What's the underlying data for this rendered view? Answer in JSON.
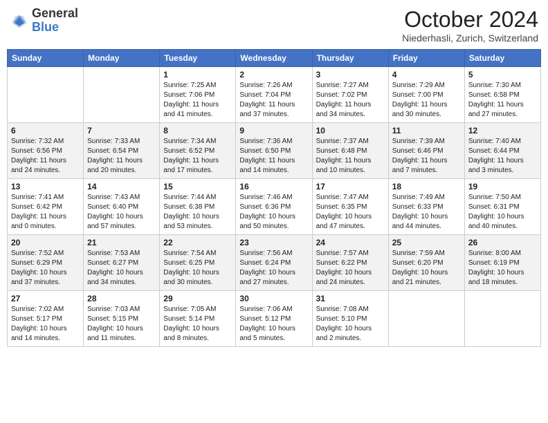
{
  "header": {
    "logo_general": "General",
    "logo_blue": "Blue",
    "month_title": "October 2024",
    "location": "Niederhasli, Zurich, Switzerland"
  },
  "weekdays": [
    "Sunday",
    "Monday",
    "Tuesday",
    "Wednesday",
    "Thursday",
    "Friday",
    "Saturday"
  ],
  "weeks": [
    [
      {
        "day": "",
        "sunrise": "",
        "sunset": "",
        "daylight": ""
      },
      {
        "day": "",
        "sunrise": "",
        "sunset": "",
        "daylight": ""
      },
      {
        "day": "1",
        "sunrise": "Sunrise: 7:25 AM",
        "sunset": "Sunset: 7:06 PM",
        "daylight": "Daylight: 11 hours and 41 minutes."
      },
      {
        "day": "2",
        "sunrise": "Sunrise: 7:26 AM",
        "sunset": "Sunset: 7:04 PM",
        "daylight": "Daylight: 11 hours and 37 minutes."
      },
      {
        "day": "3",
        "sunrise": "Sunrise: 7:27 AM",
        "sunset": "Sunset: 7:02 PM",
        "daylight": "Daylight: 11 hours and 34 minutes."
      },
      {
        "day": "4",
        "sunrise": "Sunrise: 7:29 AM",
        "sunset": "Sunset: 7:00 PM",
        "daylight": "Daylight: 11 hours and 30 minutes."
      },
      {
        "day": "5",
        "sunrise": "Sunrise: 7:30 AM",
        "sunset": "Sunset: 6:58 PM",
        "daylight": "Daylight: 11 hours and 27 minutes."
      }
    ],
    [
      {
        "day": "6",
        "sunrise": "Sunrise: 7:32 AM",
        "sunset": "Sunset: 6:56 PM",
        "daylight": "Daylight: 11 hours and 24 minutes."
      },
      {
        "day": "7",
        "sunrise": "Sunrise: 7:33 AM",
        "sunset": "Sunset: 6:54 PM",
        "daylight": "Daylight: 11 hours and 20 minutes."
      },
      {
        "day": "8",
        "sunrise": "Sunrise: 7:34 AM",
        "sunset": "Sunset: 6:52 PM",
        "daylight": "Daylight: 11 hours and 17 minutes."
      },
      {
        "day": "9",
        "sunrise": "Sunrise: 7:36 AM",
        "sunset": "Sunset: 6:50 PM",
        "daylight": "Daylight: 11 hours and 14 minutes."
      },
      {
        "day": "10",
        "sunrise": "Sunrise: 7:37 AM",
        "sunset": "Sunset: 6:48 PM",
        "daylight": "Daylight: 11 hours and 10 minutes."
      },
      {
        "day": "11",
        "sunrise": "Sunrise: 7:39 AM",
        "sunset": "Sunset: 6:46 PM",
        "daylight": "Daylight: 11 hours and 7 minutes."
      },
      {
        "day": "12",
        "sunrise": "Sunrise: 7:40 AM",
        "sunset": "Sunset: 6:44 PM",
        "daylight": "Daylight: 11 hours and 3 minutes."
      }
    ],
    [
      {
        "day": "13",
        "sunrise": "Sunrise: 7:41 AM",
        "sunset": "Sunset: 6:42 PM",
        "daylight": "Daylight: 11 hours and 0 minutes."
      },
      {
        "day": "14",
        "sunrise": "Sunrise: 7:43 AM",
        "sunset": "Sunset: 6:40 PM",
        "daylight": "Daylight: 10 hours and 57 minutes."
      },
      {
        "day": "15",
        "sunrise": "Sunrise: 7:44 AM",
        "sunset": "Sunset: 6:38 PM",
        "daylight": "Daylight: 10 hours and 53 minutes."
      },
      {
        "day": "16",
        "sunrise": "Sunrise: 7:46 AM",
        "sunset": "Sunset: 6:36 PM",
        "daylight": "Daylight: 10 hours and 50 minutes."
      },
      {
        "day": "17",
        "sunrise": "Sunrise: 7:47 AM",
        "sunset": "Sunset: 6:35 PM",
        "daylight": "Daylight: 10 hours and 47 minutes."
      },
      {
        "day": "18",
        "sunrise": "Sunrise: 7:49 AM",
        "sunset": "Sunset: 6:33 PM",
        "daylight": "Daylight: 10 hours and 44 minutes."
      },
      {
        "day": "19",
        "sunrise": "Sunrise: 7:50 AM",
        "sunset": "Sunset: 6:31 PM",
        "daylight": "Daylight: 10 hours and 40 minutes."
      }
    ],
    [
      {
        "day": "20",
        "sunrise": "Sunrise: 7:52 AM",
        "sunset": "Sunset: 6:29 PM",
        "daylight": "Daylight: 10 hours and 37 minutes."
      },
      {
        "day": "21",
        "sunrise": "Sunrise: 7:53 AM",
        "sunset": "Sunset: 6:27 PM",
        "daylight": "Daylight: 10 hours and 34 minutes."
      },
      {
        "day": "22",
        "sunrise": "Sunrise: 7:54 AM",
        "sunset": "Sunset: 6:25 PM",
        "daylight": "Daylight: 10 hours and 30 minutes."
      },
      {
        "day": "23",
        "sunrise": "Sunrise: 7:56 AM",
        "sunset": "Sunset: 6:24 PM",
        "daylight": "Daylight: 10 hours and 27 minutes."
      },
      {
        "day": "24",
        "sunrise": "Sunrise: 7:57 AM",
        "sunset": "Sunset: 6:22 PM",
        "daylight": "Daylight: 10 hours and 24 minutes."
      },
      {
        "day": "25",
        "sunrise": "Sunrise: 7:59 AM",
        "sunset": "Sunset: 6:20 PM",
        "daylight": "Daylight: 10 hours and 21 minutes."
      },
      {
        "day": "26",
        "sunrise": "Sunrise: 8:00 AM",
        "sunset": "Sunset: 6:19 PM",
        "daylight": "Daylight: 10 hours and 18 minutes."
      }
    ],
    [
      {
        "day": "27",
        "sunrise": "Sunrise: 7:02 AM",
        "sunset": "Sunset: 5:17 PM",
        "daylight": "Daylight: 10 hours and 14 minutes."
      },
      {
        "day": "28",
        "sunrise": "Sunrise: 7:03 AM",
        "sunset": "Sunset: 5:15 PM",
        "daylight": "Daylight: 10 hours and 11 minutes."
      },
      {
        "day": "29",
        "sunrise": "Sunrise: 7:05 AM",
        "sunset": "Sunset: 5:14 PM",
        "daylight": "Daylight: 10 hours and 8 minutes."
      },
      {
        "day": "30",
        "sunrise": "Sunrise: 7:06 AM",
        "sunset": "Sunset: 5:12 PM",
        "daylight": "Daylight: 10 hours and 5 minutes."
      },
      {
        "day": "31",
        "sunrise": "Sunrise: 7:08 AM",
        "sunset": "Sunset: 5:10 PM",
        "daylight": "Daylight: 10 hours and 2 minutes."
      },
      {
        "day": "",
        "sunrise": "",
        "sunset": "",
        "daylight": ""
      },
      {
        "day": "",
        "sunrise": "",
        "sunset": "",
        "daylight": ""
      }
    ]
  ]
}
